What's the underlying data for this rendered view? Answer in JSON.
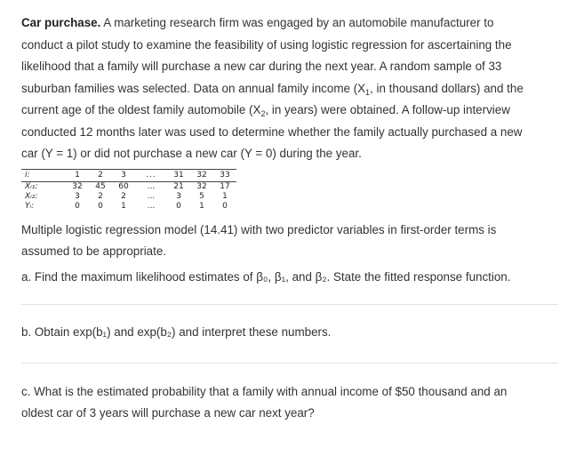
{
  "problem": {
    "title": "Car purchase.",
    "intro_line1": " A marketing research firm was engaged by an automobile manufacturer to",
    "intro_line2": "conduct a pilot study to examine the feasibility of using logistic regression for ascertaining the",
    "intro_line3": "likelihood that a family will purchase a new car during the next year. A random sample of 33",
    "intro_line4": "suburban families was selected. Data on annual family income (X",
    "intro_line4_sub": "1",
    "intro_line4_tail": ", in thousand dollars) and the",
    "intro_line5": "current age of the oldest family automobile (X",
    "intro_line5_sub": "2",
    "intro_line5_tail": ", in years) were obtained. A follow-up interview",
    "intro_line6": "conducted 12 months later was used to determine whether the family actually purchased a new",
    "intro_line7": "car (Y = 1) or did not purchase a new car (Y = 0) during the year."
  },
  "table": {
    "header_label": "i:",
    "columns": [
      "1",
      "2",
      "3",
      "...",
      "31",
      "32",
      "33"
    ],
    "rows": [
      {
        "label": "Xᵢ₁:",
        "values": [
          "32",
          "45",
          "60",
          "...",
          "21",
          "32",
          "17"
        ]
      },
      {
        "label": "Xᵢ₂:",
        "values": [
          "3",
          "2",
          "2",
          "...",
          "3",
          "5",
          "1"
        ]
      },
      {
        "label": "Yᵢ:",
        "values": [
          "0",
          "0",
          "1",
          "...",
          "0",
          "1",
          "0"
        ]
      }
    ]
  },
  "model_text_line1": "Multiple logistic regression model (14.41) with two predictor variables in first-order terms is",
  "model_text_line2": "assumed to be appropriate.",
  "question_a": "a. Find the maximum likelihood estimates of β₀, β₁, and β₂. State the fitted response function.",
  "question_b": "b. Obtain exp(b₁) and exp(b₂) and interpret these numbers.",
  "question_c_line1": "c. What is the estimated probability that a family with annual income of $50 thousand and an",
  "question_c_line2": "oldest car of 3 years will purchase a new car next year?"
}
